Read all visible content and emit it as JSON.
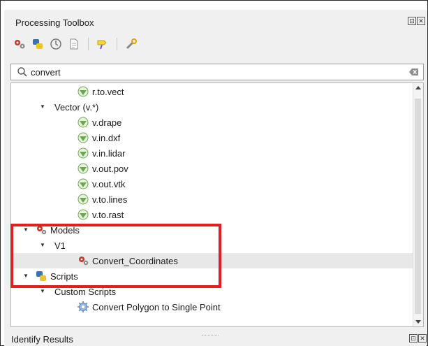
{
  "panel": {
    "title": "Processing Toolbox",
    "float_glyph": "⊡",
    "close_glyph": "✕"
  },
  "toolbar": {
    "icons": [
      "models-icon",
      "python-icon",
      "history-icon",
      "results-viewer-icon",
      "edit-features-icon",
      "options-icon"
    ]
  },
  "search": {
    "value": "convert",
    "placeholder": "Search…"
  },
  "tree": {
    "r_to_vect": "r.to.vect",
    "vector_group": "Vector (v.*)",
    "v_drape": "v.drape",
    "v_in_dxf": "v.in.dxf",
    "v_in_lidar": "v.in.lidar",
    "v_out_pov": "v.out.pov",
    "v_out_vtk": "v.out.vtk",
    "v_to_lines": "v.to.lines",
    "v_to_rast": "v.to.rast",
    "models": "Models",
    "v1": "V1",
    "convert_coordinates": "Convert_Coordinates",
    "scripts": "Scripts",
    "custom_scripts": "Custom Scripts",
    "convert_polygon": "Convert Polygon to Single Point"
  },
  "bottom_panel": {
    "title": "Identify Results"
  },
  "colors": {
    "highlight": "#e02020",
    "grass_green": "#6aa84f"
  }
}
